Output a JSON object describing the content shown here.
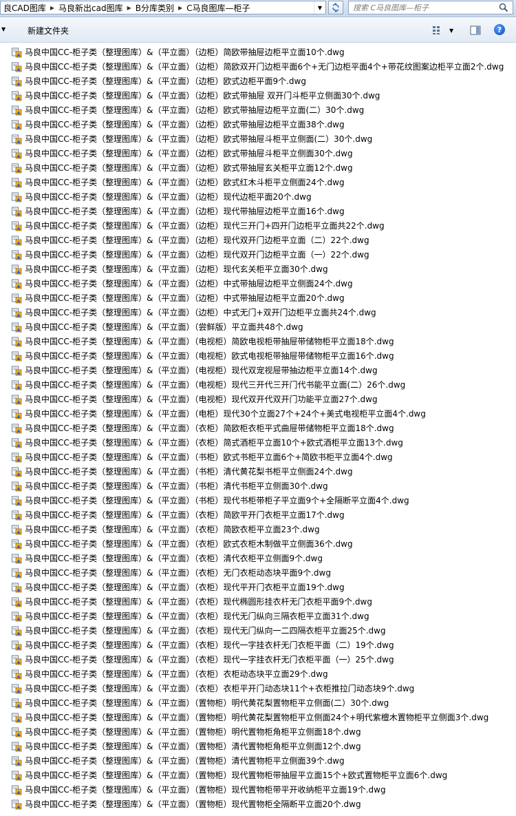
{
  "address": {
    "crumbs": [
      "良CAD图库",
      "马良新出cad图库",
      "B分库类别",
      "C马良图库—柜子"
    ],
    "search_placeholder": "搜索 C马良图库—柜子"
  },
  "toolbar": {
    "new_folder": "新建文件夹",
    "help": "?"
  },
  "files": [
    "马良中国CC-柜子类（整理图库）&（平立面）（边柜）简欧带抽屉边柜平立面10个.dwg",
    "马良中国CC-柜子类（整理图库）&（平立面）（边柜）简欧双开门边柜平面6个+无门边柜平面4个+带花纹图案边柜平立面2个.dwg",
    "马良中国CC-柜子类（整理图库）&（平立面）（边柜）欧式边柜平面9个.dwg",
    "马良中国CC-柜子类（整理图库）&（平立面）（边柜）欧式带抽屉 双开门斗柜平立侧面30个.dwg",
    "马良中国CC-柜子类（整理图库）&（平立面）（边柜）欧式带抽屉边柜平立面(二）30个.dwg",
    "马良中国CC-柜子类（整理图库）&（平立面）（边柜）欧式带抽屉边柜平立面38个.dwg",
    "马良中国CC-柜子类（整理图库）&（平立面）（边柜）欧式带抽屉斗柜平立侧面(二）30个.dwg",
    "马良中国CC-柜子类（整理图库）&（平立面）（边柜）欧式带抽屉斗柜平立侧面30个.dwg",
    "马良中国CC-柜子类（整理图库）&（平立面）（边柜）欧式带抽屉玄关柜平立面12个.dwg",
    "马良中国CC-柜子类（整理图库）&（平立面）（边柜）欧式红木斗柜平立侧面24个.dwg",
    "马良中国CC-柜子类（整理图库）&（平立面）（边柜）现代边柜平面20个.dwg",
    "马良中国CC-柜子类（整理图库）&（平立面）（边柜）现代带抽屉边柜平立面16个.dwg",
    "马良中国CC-柜子类（整理图库）&（平立面）（边柜）现代三开门+四开门边柜平立面共22个.dwg",
    "马良中国CC-柜子类（整理图库）&（平立面）（边柜）现代双开门边柜平立面（二）22个.dwg",
    "马良中国CC-柜子类（整理图库）&（平立面）（边柜）现代双开门边柜平立面（一）22个.dwg",
    "马良中国CC-柜子类（整理图库）&（平立面）（边柜）现代玄关柜平立面30个.dwg",
    "马良中国CC-柜子类（整理图库）&（平立面）（边柜）中式带抽屉边柜平立侧面24个.dwg",
    "马良中国CC-柜子类（整理图库）&（平立面）（边柜）中式带抽屉边柜平立面20个.dwg",
    "马良中国CC-柜子类（整理图库）&（平立面）（边柜）中式无门+双开门边柜平立面共24个.dwg",
    "马良中国CC-柜子类（整理图库）&（平立面）（尝鲜版）平立面共48个.dwg",
    "马良中国CC-柜子类（整理图库）&（平立面）（电视柜）简欧电视柜带抽屉带储物柜平立面18个.dwg",
    "马良中国CC-柜子类（整理图库）&（平立面）（电视柜）欧式电视柜带抽屉带储物柜平立面16个.dwg",
    "马良中国CC-柜子类（整理图库）&（平立面）（电视柜）现代双宠视屉带抽边柜平立面14个.dwg",
    "马良中国CC-柜子类（整理图库）&（平立面）（电视柜）现代三开代三开门代书能平立面(二）26个.dwg",
    "马良中国CC-柜子类（整理图库）&（平立面）（电视柜）现代双开代双开门功能平立面27个.dwg",
    "马良中国CC-柜子类（整理图库）&（平立面）（电柜）现代30个立面27个+24个+美式电视柜平立面4个.dwg",
    "马良中国CC-柜子类（整理图库）&（平立面）（衣柜）简欧柜衣柜平式曲屉带储物柜平立面18个.dwg",
    "马良中国CC-柜子类（整理图库）&（平立面）（衣柜）简式酒柜平立面10个+欧式酒柜平立面13个.dwg",
    "马良中国CC-柜子类（整理图库）&（平立面）（书柜）欧式书柜平立面6个+简欧书柜平立面4个.dwg",
    "马良中国CC-柜子类（整理图库）&（平立面）（书柜）清代黄花梨书柜平立侧面24个.dwg",
    "马良中国CC-柜子类（整理图库）&（平立面）（书柜）清代书柜平立侧面30个.dwg",
    "马良中国CC-柜子类（整理图库）&（平立面）（书柜）现代书柜带柜子平立面9个+全隔断平立面4个.dwg",
    "马良中国CC-柜子类（整理图库）&（平立面）（衣柜）简欧平开门衣柜平立面17个.dwg",
    "马良中国CC-柜子类（整理图库）&（平立面）（衣柜）简欧衣柜平立面23个.dwg",
    "马良中国CC-柜子类（整理图库）&（平立面）（衣柜）欧式衣柜木制做平立侧面36个.dwg",
    "马良中国CC-柜子类（整理图库）&（平立面）（衣柜）清代衣柜平立侧面9个.dwg",
    "马良中国CC-柜子类（整理图库）&（平立面）（衣柜）无门衣柜动态块平面9个.dwg",
    "马良中国CC-柜子类（整理图库）&（平立面）（衣柜）现代平开门衣柜平立面19个.dwg",
    "马良中国CC-柜子类（整理图库）&（平立面）（衣柜）现代椭圆形挂衣杆无门衣柜平面9个.dwg",
    "马良中国CC-柜子类（整理图库）&（平立面）（衣柜）现代无门纵向三隔衣柜平立面31个.dwg",
    "马良中国CC-柜子类（整理图库）&（平立面）（衣柜）现代无门纵向一二四隔衣柜平立面25个.dwg",
    "马良中国CC-柜子类（整理图库）&（平立面）（衣柜）现代一字挂衣杆无门衣柜平面（二）19个.dwg",
    "马良中国CC-柜子类（整理图库）&（平立面）（衣柜）现代一字挂衣杆无门衣柜平面（一）25个.dwg",
    "马良中国CC-柜子类（整理图库）&（平立面）（衣柜）衣柜动态块平立面29个.dwg",
    "马良中国CC-柜子类（整理图库）&（平立面）（衣柜）衣柜平开门动态块11个+衣柜推拉门动态块9个.dwg",
    "马良中国CC-柜子类（整理图库）&（平立面）（置物柜）明代黄花梨置物柜平立侧面(二）30个.dwg",
    "马良中国CC-柜子类（整理图库）&（平立面）（置物柜）明代黄花梨置物柜平立侧面24个+明代紫檀木置物柜平立侧面3个.dwg",
    "马良中国CC-柜子类（整理图库）&（平立面）（置物柜）明代置物柜角柜平立侧面18个.dwg",
    "马良中国CC-柜子类（整理图库）&（平立面）（置物柜）清代置物柜角柜平立侧面12个.dwg",
    "马良中国CC-柜子类（整理图库）&（平立面）（置物柜）清代置物柜平立侧面39个.dwg",
    "马良中国CC-柜子类（整理图库）&（平立面）（置物柜）现代置物柜带抽屉平立面15个+欧式置物柜平立面6个.dwg",
    "马良中国CC-柜子类（整理图库）&（平立面）（置物柜）现代置物柜带平开收纳柜平立面19个.dwg",
    "马良中国CC-柜子类（整理图库）&（平立面）（置物柜）现代置物柜全隔断平立面20个.dwg"
  ]
}
